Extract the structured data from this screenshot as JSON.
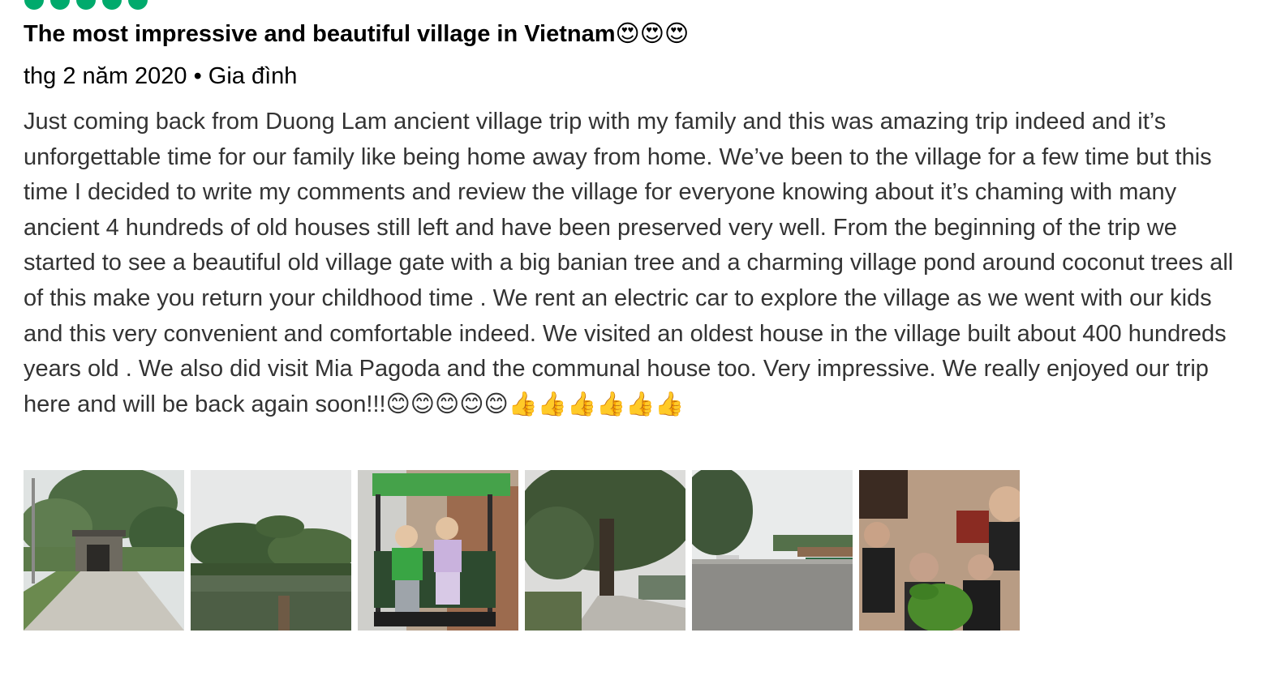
{
  "review": {
    "rating_bubbles": 5,
    "title": "The most impressive and beautiful village in Vietnam😍😍😍",
    "meta": "thg 2 năm 2020 • Gia đình",
    "body": "Just coming back from Duong Lam ancient village trip with my family and this was amazing trip indeed and it’s unforgettable time for our family like being home away from home. We’ve been to the village for a few time but this time I decided to write my comments and review the village for everyone knowing about it’s chaming with many ancient 4 hundreds of old houses still left and have been preserved very well. From the beginning of the trip we started to see a beautiful old village gate with a big banian tree and a charming village pond around coconut trees all of this make you return your childhood time . We rent an electric car to explore the village as we went with our kids and this very convenient and comfortable indeed. We visited an oldest house in the village built about 400 hundreds years old . We also did visit Mia Pagoda and the communal house too. Very impressive. We really enjoyed our trip here and will be back again soon!!!😊😊😊😊😊👍👍👍👍👍👍",
    "photos": [
      {
        "subject": "village-gate"
      },
      {
        "subject": "village-pond"
      },
      {
        "subject": "electric-car-kids"
      },
      {
        "subject": "banyan-tree-road"
      },
      {
        "subject": "parking-street"
      },
      {
        "subject": "family-indoor"
      }
    ]
  },
  "colors": {
    "rating_green": "#00aa6c",
    "title_text": "#000000",
    "body_text": "#333333"
  }
}
